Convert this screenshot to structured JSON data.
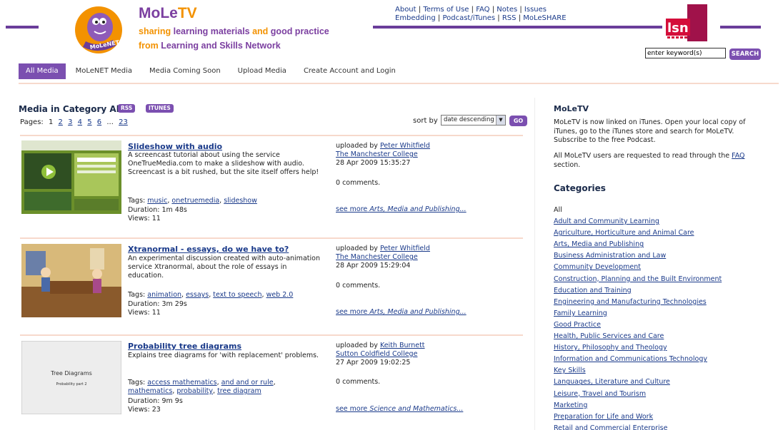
{
  "brand": {
    "title_mole": "MoLe",
    "title_tv": "TV",
    "tagline1_a": "sharing ",
    "tagline1_b": "learning materials ",
    "tagline1_c": "and ",
    "tagline1_d": "good practice",
    "tagline2_a": "from ",
    "tagline2_b": "Learning and Skills Network",
    "logo_text": "MoLeNET",
    "lsn_text": "lsn"
  },
  "toplinks": {
    "row1": [
      "About",
      "Terms of Use",
      "FAQ",
      "Notes",
      "Issues"
    ],
    "row2": [
      "Embedding",
      "Podcast/iTunes",
      "RSS",
      "MoLeSHARE"
    ]
  },
  "search": {
    "placeholder": "enter keyword(s)",
    "value": "enter keyword(s)",
    "button": "SEARCH"
  },
  "nav": [
    "All Media",
    "MoLeNET Media",
    "Media Coming Soon",
    "Upload Media",
    "Create Account and Login"
  ],
  "main": {
    "title": "Media in Category All",
    "rss": "RSS",
    "itunes": "ITUNES",
    "pages_label": "Pages:",
    "current_page": "1",
    "pages": [
      "2",
      "3",
      "4",
      "5",
      "6"
    ],
    "ellipsis": "...",
    "last_page": "23",
    "sort_label": "sort by",
    "sort_value": "date descending",
    "go": "GO"
  },
  "items": [
    {
      "title": "Slideshow with audio",
      "desc": "A screencast tutorial about using the service OneTrueMedia.com to make a slideshow with audio. Screencast is a bit rushed, but the site itself offers help!",
      "tags_label": "Tags:",
      "tags": [
        "music",
        "onetruemedia",
        "slideshow"
      ],
      "duration": "Duration: 1m 48s",
      "views": "Views: 11",
      "uploaded_by": "uploaded by",
      "user": "Peter Whitfield",
      "college": "The Manchester College",
      "date": "28 Apr 2009 15:35:27",
      "comments": "0 comments.",
      "see_more": "see more",
      "category": "Arts, Media and Publishing..."
    },
    {
      "title": "Xtranormal - essays, do we have to?",
      "desc": "An experimental discussion created with auto-animation service Xtranormal, about the role of essays in education.",
      "tags_label": "Tags:",
      "tags": [
        "animation",
        "essays",
        "text to speech",
        "web 2.0"
      ],
      "duration": "Duration: 3m 29s",
      "views": "Views: 11",
      "uploaded_by": "uploaded by",
      "user": "Peter Whitfield",
      "college": "The Manchester College",
      "date": "28 Apr 2009 15:29:04",
      "comments": "0 comments.",
      "see_more": "see more",
      "category": "Arts, Media and Publishing..."
    },
    {
      "title": "Probability tree diagrams",
      "desc": "Explains tree diagrams for 'with replacement' problems.",
      "tags_label": "Tags:",
      "tags": [
        "access mathematics",
        "and and or rule",
        "mathematics",
        "probability",
        "tree diagram"
      ],
      "duration": "Duration: 9m 9s",
      "views": "Views: 23",
      "uploaded_by": "uploaded by",
      "user": "Keith Burnett",
      "college": "Sutton Coldfield College",
      "date": "27 Apr 2009 19:02:25",
      "comments": "0 comments.",
      "see_more": "see more",
      "category": "Science and Mathematics...",
      "thumb_title": "Tree Diagrams",
      "thumb_sub": "Probability part 2"
    }
  ],
  "sidebar": {
    "title": "MoLeTV",
    "p1": "MoLeTV is now linked on iTunes. Open your local copy of iTunes, go to the iTunes store and search for MoLeTV. Subscribe to the free Podcast.",
    "p2_a": "All MoLeTV users are requested to read through the ",
    "p2_link": "FAQ",
    "p2_b": "section.",
    "categories_title": "Categories",
    "categories_all": "All",
    "categories": [
      "Adult and Community Learning",
      "Agriculture, Horticulture and Animal Care",
      "Arts, Media and Publishing",
      "Business Administration and Law",
      "Community Development",
      "Construction, Planning and the Built Environment",
      "Education and Training",
      "Engineering and Manufacturing Technologies",
      "Family Learning",
      "Good Practice",
      "Health, Public Services and Care",
      "History, Philosophy and Theology",
      "Information and Communications Technology",
      "Key Skills",
      "Languages, Literature and Culture",
      "Leisure, Travel and Tourism",
      "Marketing",
      "Preparation for Life and Work",
      "Retail and Commercial Enterprise"
    ]
  },
  "colors": {
    "accent": "#7b4fb0",
    "brand_orange": "#f39200",
    "link": "#1a3a8a",
    "rule": "#f7d9cc",
    "lsn": "#a0124a"
  }
}
